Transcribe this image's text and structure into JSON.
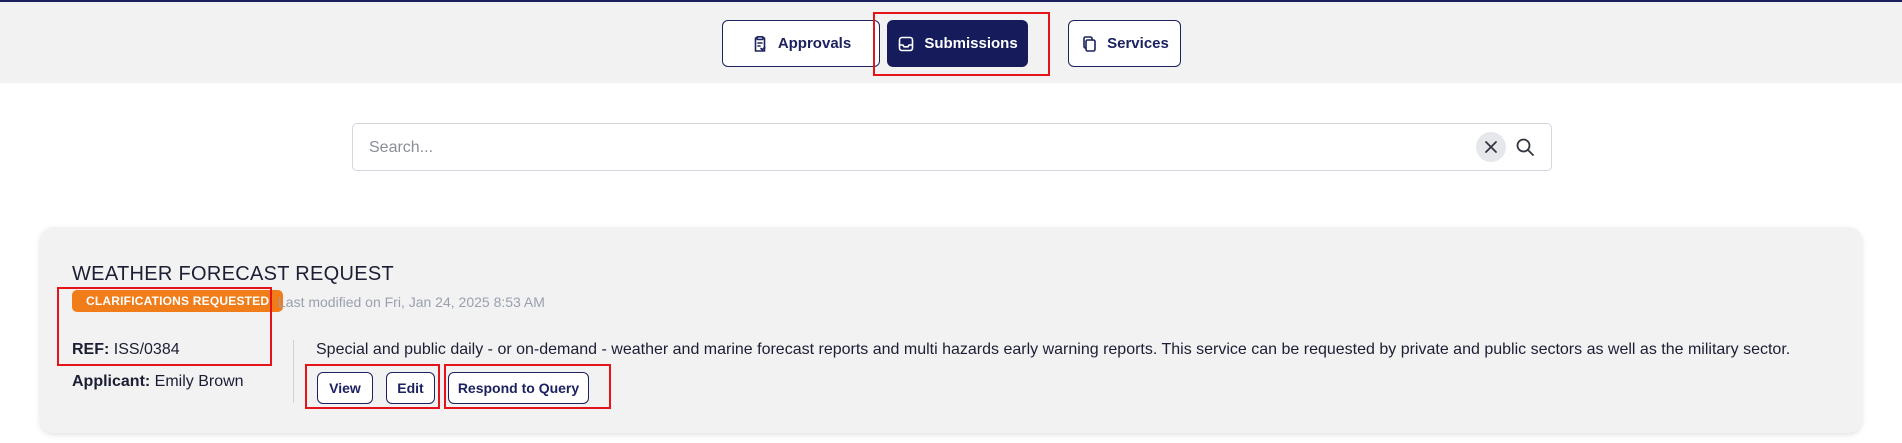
{
  "tabs": {
    "approvals_label": "Approvals",
    "submissions_label": "Submissions",
    "services_label": "Services"
  },
  "search": {
    "placeholder": "Search..."
  },
  "card": {
    "title": "WEATHER FORECAST REQUEST",
    "status": "CLARIFICATIONS REQUESTED",
    "last_modified": "Last modified on Fri, Jan 24, 2025 8:53 AM",
    "ref_label": "REF:",
    "ref_value": "ISS/0384",
    "applicant_label": "Applicant:",
    "applicant_value": "Emily Brown",
    "description": "Special and public daily - or on-demand - weather and marine forecast reports and multi hazards early warning reports. This service can be requested by private and public sectors as well as the military sector.",
    "buttons": {
      "view": "View",
      "edit": "Edit",
      "respond": "Respond to Query"
    }
  },
  "colors": {
    "navy": "#161b5c",
    "badge_orange": "#f07c1a",
    "highlight_red": "#e5141b"
  },
  "icons": {
    "approvals": "clipboard-check-icon",
    "submissions": "inbox-icon",
    "services": "copy-icon",
    "clear": "close-icon",
    "search": "search-icon"
  }
}
